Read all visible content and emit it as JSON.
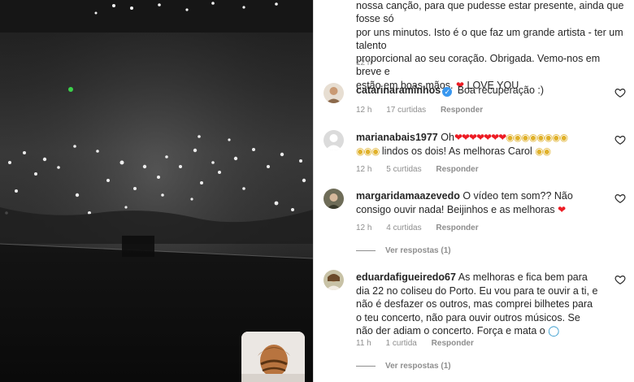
{
  "media": {
    "description_icon": "video-frame-concert",
    "pip_icon": "video-thumbnail"
  },
  "caption": {
    "line1": "nossa canção, para que pudesse estar presente, ainda que fosse só",
    "line2": "por uns minutos. Isto é o que faz um grande artista - ter um talento",
    "line3": "proporcional ao seu coração. Obrigada. Vemo-nos em breve e",
    "line4": "estão em boas mãos.",
    "love": "LOVE YOU",
    "time": "12 h"
  },
  "comments": [
    {
      "username": "catarinaraminhos",
      "verified": true,
      "text": "Boa recuperação :)",
      "time": "12 h",
      "likes": "17 curtidas",
      "reply": "Responder"
    },
    {
      "username": "marianabais1977",
      "text_prefix": "Oh",
      "text_suffix": "lindos os dois! As melhoras Carol",
      "time": "12 h",
      "likes": "5 curtidas",
      "reply": "Responder"
    },
    {
      "username": "margaridamaazevedo",
      "text": "O vídeo tem som?? Não consigo ouvir nada! Beijinhos e as melhoras",
      "time": "12 h",
      "likes": "4 curtidas",
      "reply": "Responder",
      "view_replies": "Ver respostas (1)"
    },
    {
      "username": "eduardafigueiredo67",
      "text": "As melhoras e fica bem para dia 22 no coliseu do Porto. Eu vou para te ouvir a ti, e não é desfazer os outros, mas comprei bilhetes para o teu concerto, não para ouvir outros músicos. Se não der adiam o concerto. Força e mata o",
      "time": "11 h",
      "likes": "1 curtida",
      "reply": "Responder",
      "view_replies": "Ver respostas (1)"
    }
  ],
  "colors": {
    "heart": "#ed1c24",
    "verified": "#3897f0",
    "meta_text": "#8e8e8e"
  }
}
